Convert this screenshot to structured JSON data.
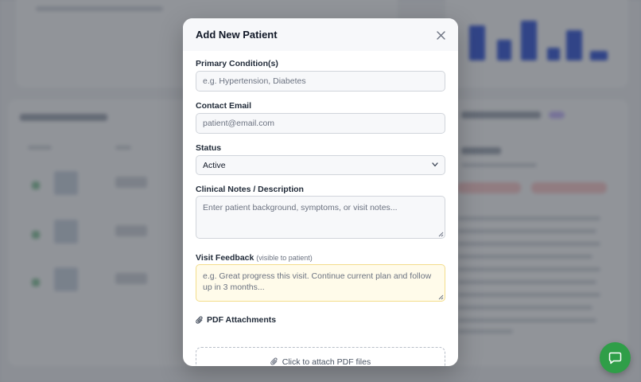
{
  "modal": {
    "title": "Add New Patient",
    "fields": {
      "condition": {
        "label": "Primary Condition(s)",
        "placeholder": "e.g. Hypertension, Diabetes",
        "value": ""
      },
      "email": {
        "label": "Contact Email",
        "placeholder": "patient@email.com",
        "value": ""
      },
      "status": {
        "label": "Status",
        "selected": "Active"
      },
      "notes": {
        "label": "Clinical Notes / Description",
        "placeholder": "Enter patient background, symptoms, or visit notes..."
      },
      "feedback": {
        "label": "Visit Feedback",
        "sublabel": "(visible to patient)",
        "placeholder": "e.g. Great progress this visit. Continue current plan and follow up in 3 months..."
      },
      "attachments": {
        "label": "PDF Attachments",
        "dropzone_text": "Click to attach PDF files"
      }
    }
  },
  "colors": {
    "accent_green": "#2f9e48",
    "feedback_bg": "#fffbea",
    "feedback_border": "#f3dd8c",
    "chart_bar": "#2b4fd8"
  },
  "icons": [
    "close-icon",
    "chevron-down-icon",
    "paperclip-icon",
    "chat-icon"
  ]
}
